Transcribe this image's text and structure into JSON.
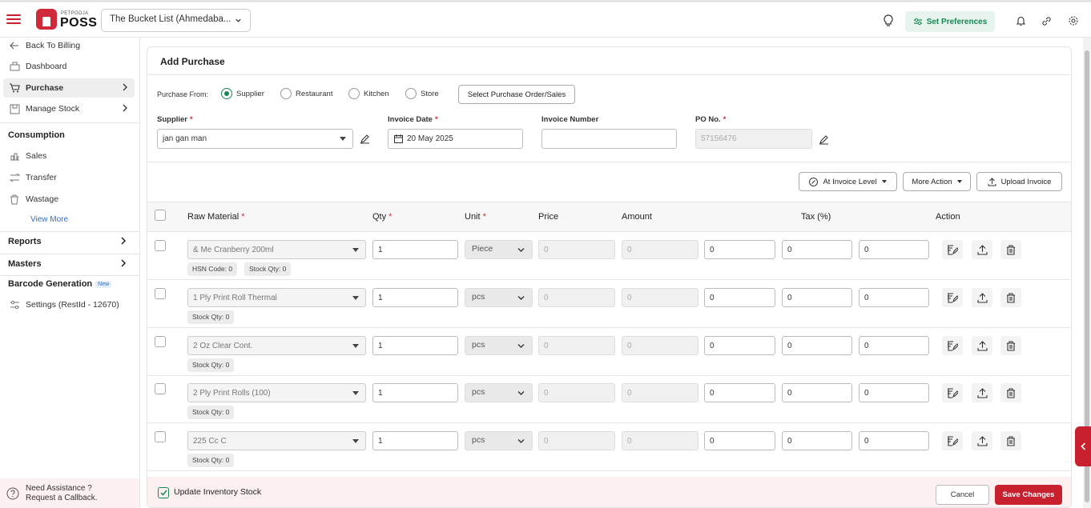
{
  "brand": {
    "small": "PETPOOJA",
    "big": "POSS",
    "accent": "#c8202f",
    "green": "#198754"
  },
  "header": {
    "outlet": "The Bucket List (Ahmedaba...",
    "preferences": "Set Preferences"
  },
  "sidebar": {
    "back": "Back To Billing",
    "dashboard": "Dashboard",
    "purchase": "Purchase",
    "manage_stock": "Manage Stock",
    "consumption": "Consumption",
    "sales": "Sales",
    "transfer": "Transfer",
    "wastage": "Wastage",
    "view_more": "View More",
    "reports": "Reports",
    "masters": "Masters",
    "barcode": "Barcode Generation",
    "new_badge": "New",
    "settings": "Settings (RestId - 12670)",
    "assist_1": "Need Assistance ?",
    "assist_2": "Request a Callback."
  },
  "page": {
    "title": "Add Purchase",
    "purchase_from": "Purchase From:",
    "options": [
      "Supplier",
      "Restaurant",
      "Kitchen",
      "Store"
    ],
    "selected_option": "Supplier",
    "select_po_btn": "Select Purchase Order/Sales",
    "supplier_label": "Supplier",
    "supplier_value": "jan gan man",
    "invoice_date_label": "Invoice Date",
    "invoice_date_value": "20 May 2025",
    "invoice_number_label": "Invoice Number",
    "invoice_number_value": "",
    "po_label": "PO No.",
    "po_value": "57156476",
    "at_invoice_level": "At Invoice Level",
    "more_action": "More Action",
    "upload_invoice": "Upload Invoice"
  },
  "table": {
    "headers": {
      "raw_material": "Raw Material",
      "qty": "Qty",
      "unit": "Unit",
      "price": "Price",
      "amount": "Amount",
      "tax": "Tax (%)",
      "action": "Action"
    },
    "rows": [
      {
        "material": "& Me Cranberry 200ml",
        "qty": "1",
        "unit": "Piece",
        "price": "0",
        "amount": "0",
        "tax1": "0",
        "tax2": "0",
        "tax3": "0",
        "chips": [
          "HSN Code: 0",
          "Stock Qty: 0"
        ]
      },
      {
        "material": "1 Ply Print Roll Thermal",
        "qty": "1",
        "unit": "pcs",
        "price": "0",
        "amount": "0",
        "tax1": "0",
        "tax2": "0",
        "tax3": "0",
        "chips": [
          "Stock Qty: 0"
        ]
      },
      {
        "material": "2 Oz Clear Cont.",
        "qty": "1",
        "unit": "pcs",
        "price": "0",
        "amount": "0",
        "tax1": "0",
        "tax2": "0",
        "tax3": "0",
        "chips": [
          "Stock Qty: 0"
        ]
      },
      {
        "material": "2 Ply Print Rolls (100)",
        "qty": "1",
        "unit": "pcs",
        "price": "0",
        "amount": "0",
        "tax1": "0",
        "tax2": "0",
        "tax3": "0",
        "chips": [
          "Stock Qty: 0"
        ]
      },
      {
        "material": "225 Cc C",
        "qty": "1",
        "unit": "pcs",
        "price": "0",
        "amount": "0",
        "tax1": "0",
        "tax2": "0",
        "tax3": "0",
        "chips": [
          "Stock Qty: 0"
        ]
      }
    ]
  },
  "footer": {
    "update_inventory": "Update Inventory Stock",
    "cancel": "Cancel",
    "save": "Save Changes"
  }
}
